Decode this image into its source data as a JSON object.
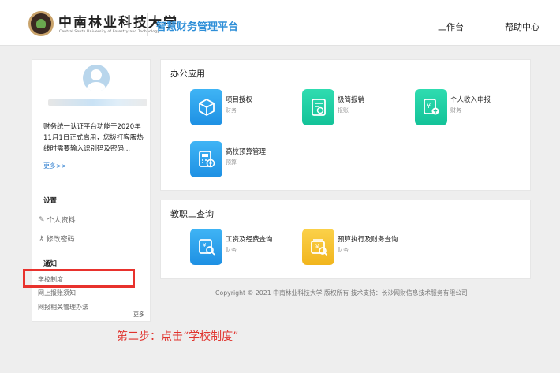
{
  "header": {
    "logo_cn": "中南林业科技大学",
    "logo_en": "Central South University of Forestry and Technology",
    "platform_title": "智慧财务管理平台",
    "nav": {
      "workbench": "工作台",
      "help": "帮助中心"
    }
  },
  "sidebar": {
    "notice": "财务统一认证平台功能于2020年11月1日正式启用，您拨打客服热线时需要输入识别码及密码...",
    "more": "更多>>",
    "settings_title": "设置",
    "profile": "个人资料",
    "change_password": "修改密码",
    "notify_title": "通知",
    "notify_items": [
      "学校制度",
      "网上报账须知",
      "网报相关管理办法"
    ],
    "notify_more": "更多"
  },
  "office": {
    "title": "办公应用",
    "apps": [
      {
        "name": "项目授权",
        "sub": "财务",
        "icon": "cube-icon",
        "color": "#2a9ee9"
      },
      {
        "name": "极简报销",
        "sub": "报账",
        "icon": "invoice-icon",
        "color": "#1ccba1"
      },
      {
        "name": "个人收入申报",
        "sub": "财务",
        "icon": "income-report-icon",
        "color": "#1ccba1"
      },
      {
        "name": "高校预算管理",
        "sub": "预算",
        "icon": "budget-calculator-icon",
        "color": "#2a9ee9"
      }
    ]
  },
  "staff": {
    "title": "教职工查询",
    "apps": [
      {
        "name": "工资及经费查询",
        "sub": "财务",
        "icon": "salary-search-icon",
        "color": "#2a9ee9"
      },
      {
        "name": "预算执行及财务查询",
        "sub": "财务",
        "icon": "finance-search-icon",
        "color": "#f4bf2a"
      }
    ]
  },
  "footer": {
    "copyright": "Copyright © 2021 中南林业科技大学 版权所有 技术支持：长沙网财信息技术服务有限公司"
  },
  "annotation": {
    "step": "第二步：点击“学校制度”",
    "highlight_color": "#e8322d"
  }
}
